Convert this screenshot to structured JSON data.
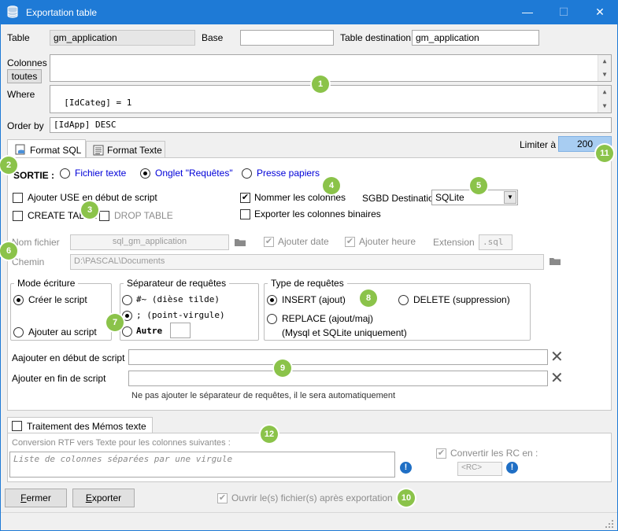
{
  "window": {
    "title": "Exportation table",
    "minimize": "—",
    "maximize": "☐",
    "close": "✕"
  },
  "top": {
    "table_label": "Table",
    "table_value": "gm_application",
    "base_label": "Base",
    "base_value": "",
    "dest_label": "Table destination",
    "dest_value": "gm_application",
    "colonnes_label": "Colonnes",
    "toutes_button": "toutes",
    "where_label": "Where",
    "where_value": "[IdCateg] = 1",
    "orderby_label": "Order by",
    "orderby_value": "[IdApp] DESC"
  },
  "tabs": {
    "sql": "Format SQL",
    "texte": "Format Texte"
  },
  "limit": {
    "label": "Limiter à",
    "value": "200"
  },
  "sortie": {
    "label": "SORTIE :",
    "options": [
      "Fichier texte",
      "Onglet \"Requêtes\"",
      "Presse papiers"
    ],
    "selected": 1
  },
  "options": {
    "use": "Ajouter USE  en début de script",
    "nommer": "Nommer les colonnes",
    "create": "CREATE TABLE",
    "drop": "DROP TABLE",
    "binaires": "Exporter les colonnes binaires",
    "sgbd_label": "SGBD Destination",
    "sgbd_value": "SQLite"
  },
  "file": {
    "nom_label": "Nom fichier",
    "nom_value": "sql_gm_application",
    "ajouter_date": "Ajouter date",
    "ajouter_heure": "Ajouter heure",
    "extension_label": "Extension",
    "extension_value": ".sql",
    "chemin_label": "Chemin",
    "chemin_value": "D:\\PASCAL\\Documents"
  },
  "mode": {
    "title": "Mode écriture",
    "creer": "Créer le script",
    "ajouter": "Ajouter au script"
  },
  "separateur": {
    "title": "Séparateur de requêtes",
    "opt1": "#~ (dièse tilde)",
    "opt2": "; (point-virgule)",
    "opt3": "Autre"
  },
  "type": {
    "title": "Type de requêtes",
    "insert": "INSERT (ajout)",
    "delete": "DELETE (suppression)",
    "replace": "REPLACE (ajout/maj)",
    "replace_note": "(Mysql et SQLite uniquement)"
  },
  "script": {
    "debut_label": "Aajouter en début de script",
    "fin_label": "Ajouter en fin de script",
    "note": "Ne pas ajouter le séparateur de requêtes, il le sera automatiquement"
  },
  "memos": {
    "tab_label": "Traitement des Mémos texte",
    "conversion_label": "Conversion RTF vers Texte pour les colonnes suivantes :",
    "conversion_placeholder": "Liste de colonnes séparées par une virgule",
    "convertir_label": "Convertir les RC en :",
    "rc_value": "<RC>"
  },
  "footer": {
    "fermer": "Fermer",
    "exporter": "Exporter",
    "ouvrir": "Ouvrir le(s) fichier(s) après exportation"
  },
  "markers": [
    "1",
    "2",
    "3",
    "4",
    "5",
    "6",
    "7",
    "8",
    "9",
    "10",
    "11",
    "12"
  ],
  "colors": {
    "titlebar": "#1e7ad6",
    "marker": "#8bc34a",
    "link_blue": "#0000d8",
    "limit_bg": "#a8cdf2"
  }
}
